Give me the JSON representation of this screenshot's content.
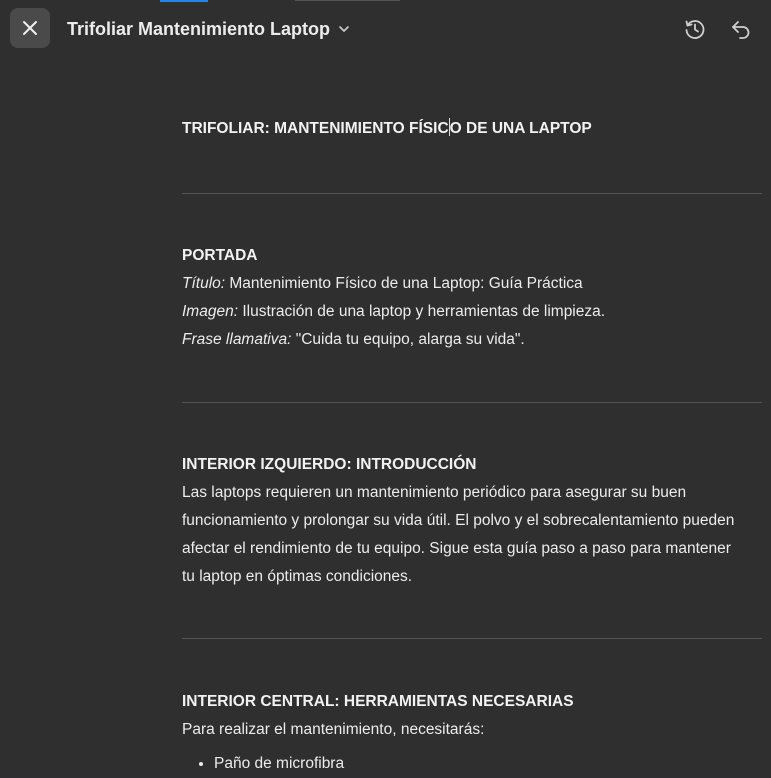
{
  "header": {
    "doc_title": "Trifoliar Mantenimiento Laptop",
    "close_icon": "close-icon",
    "dropdown_icon": "chevron-down-icon",
    "history_icon": "history-icon",
    "undo_icon": "undo-icon"
  },
  "doc": {
    "main_title_a": "TRIFOLIAR: MANTENIMIENTO FÍSIC",
    "main_title_b": "O DE UNA LAPTOP",
    "portada": {
      "heading": "PORTADA",
      "titulo_label": "Título:",
      "titulo_value": " Mantenimiento Físico de una Laptop: Guía Práctica",
      "imagen_label": "Imagen:",
      "imagen_value": " Ilustración de una laptop y herramientas de limpieza.",
      "frase_label": "Frase llamativa:",
      "frase_value": " \"Cuida tu equipo, alarga su vida\"."
    },
    "intro": {
      "heading": "INTERIOR IZQUIERDO: INTRODUCCIÓN",
      "line1": "Las laptops requieren un mantenimiento periódico para asegurar su buen",
      "line2": "funcionamiento y prolongar su vida útil. El polvo y el sobrecalentamiento pueden",
      "line3": "afectar el rendimiento de tu equipo. Sigue esta guía paso a paso para mantener",
      "line4": "tu laptop en óptimas condiciones."
    },
    "central": {
      "heading": "INTERIOR CENTRAL: HERRAMIENTAS NECESARIAS",
      "intro": "Para realizar el mantenimiento, necesitarás:",
      "items": [
        "Paño de microfibra"
      ]
    }
  }
}
